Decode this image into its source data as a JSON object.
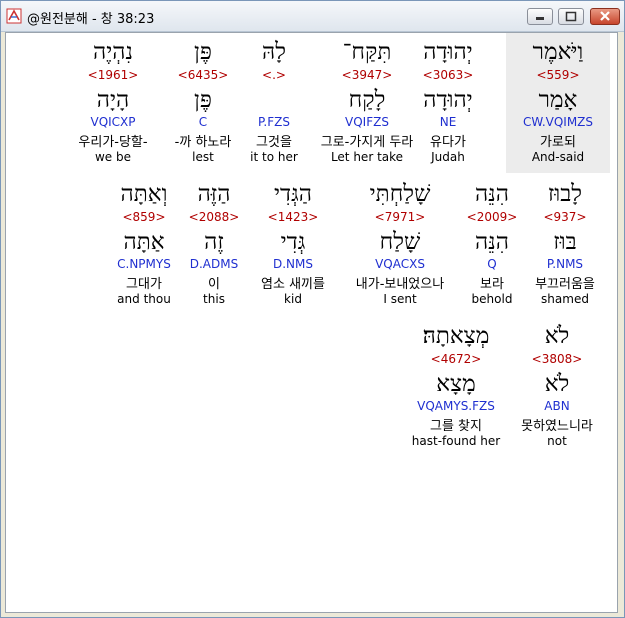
{
  "window": {
    "title": "@원전분해 - 창 38:23"
  },
  "words": [
    {
      "heb": "וַיֹּאמֶר",
      "strong": "<559>",
      "lex": "אָמַר",
      "parse": "CW.VQIMZS",
      "kor": "가로되",
      "eng": "And-said",
      "selected": true
    },
    {
      "heb": "יְהוּדָה",
      "strong": "<3063>",
      "lex": "יְהוּדָה",
      "parse": "NE",
      "kor": "유다가",
      "eng": "Judah"
    },
    {
      "heb": "תִּקַּח־",
      "strong": "<3947>",
      "lex": "לָקַח",
      "parse": "VQIFZS",
      "kor": "그로-가지게 두라",
      "eng": "Let her take"
    },
    {
      "heb": "לָהּ",
      "strong": "<.>",
      "lex": "",
      "parse": "P.FZS",
      "kor": "그것을",
      "eng": "it to her"
    },
    {
      "heb": "פֶּן",
      "strong": "<6435>",
      "lex": "פֶּן",
      "parse": "C",
      "kor": "-까 하노라",
      "eng": "lest"
    },
    {
      "heb": "נִהְיֶה",
      "strong": "<1961>",
      "lex": "הָיָה",
      "parse": "VQICXP",
      "kor": "우리가-당할-",
      "eng": "we be"
    },
    {
      "heb": "לָבוּז",
      "strong": "<937>",
      "lex": "בּוּז",
      "parse": "P.NMS",
      "kor": "부끄러움을",
      "eng": "shamed"
    },
    {
      "heb": "הִנֵּה",
      "strong": "<2009>",
      "lex": "הִנֵּה",
      "parse": "Q",
      "kor": "보라",
      "eng": "behold"
    },
    {
      "heb": "שָׁלַחְתִּי",
      "strong": "<7971>",
      "lex": "שָׁלַח",
      "parse": "VQACXS",
      "kor": "내가-보내었으나",
      "eng": "I sent"
    },
    {
      "heb": "הַגְּדִי",
      "strong": "<1423>",
      "lex": "גְּדִי",
      "parse": "D.NMS",
      "kor": "염소 새끼를",
      "eng": "kid"
    },
    {
      "heb": "הַזֶּה",
      "strong": "<2088>",
      "lex": "זֶה",
      "parse": "D.ADMS",
      "kor": "이",
      "eng": "this"
    },
    {
      "heb": "וְאַתָּה",
      "strong": "<859>",
      "lex": "אַתָּה",
      "parse": "C.NPMYS",
      "kor": "그대가",
      "eng": "and thou"
    },
    {
      "heb": "לֹא",
      "strong": "<3808>",
      "lex": "לֹא",
      "parse": "ABN",
      "kor": "못하였느니라",
      "eng": "not"
    },
    {
      "heb": "מְצָאתָהּ׃",
      "strong": "<4672>",
      "lex": "מָצָא",
      "parse": "VQAMYS.FZS",
      "kor": "그를 찾지",
      "eng": "hast-found her"
    }
  ]
}
